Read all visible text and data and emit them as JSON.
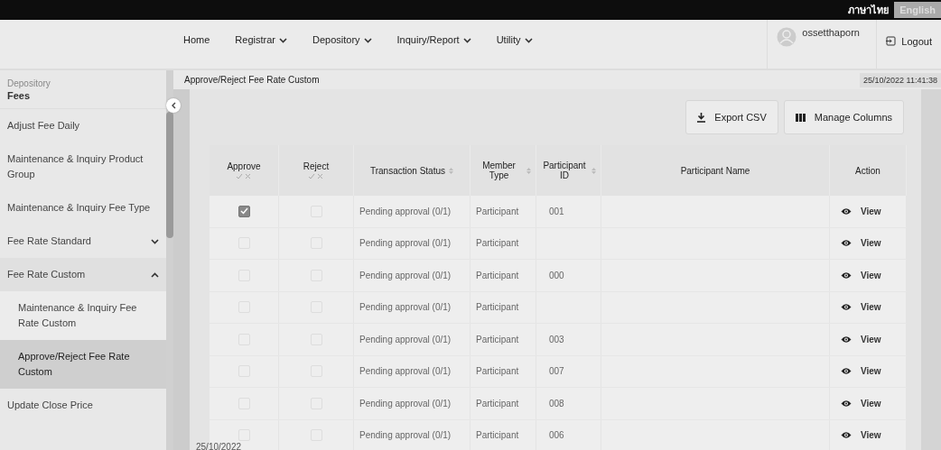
{
  "top_bar": {
    "languages": [
      {
        "label": "ภาษาไทย",
        "selected": true
      },
      {
        "label": "English",
        "selected": false
      }
    ]
  },
  "nav": {
    "items": [
      {
        "label": "Home",
        "dropdown": false
      },
      {
        "label": "Registrar",
        "dropdown": true
      },
      {
        "label": "Depository",
        "dropdown": true
      },
      {
        "label": "Inquiry/Report",
        "dropdown": true
      },
      {
        "label": "Utility",
        "dropdown": true
      }
    ],
    "username": "ossetthaporn",
    "logout": "Logout"
  },
  "sidebar": {
    "section": "Depository",
    "title": "Fees",
    "items": [
      {
        "label": "Adjust Fee Daily",
        "selected": false
      },
      {
        "label": "Maintenance & Inquiry Product Group",
        "selected": false
      },
      {
        "label": "Maintenance & Inquiry Fee Type",
        "selected": false
      },
      {
        "label": "Fee Rate Standard",
        "selected": false,
        "expanded": false
      },
      {
        "label": "Fee Rate Custom",
        "selected": false,
        "expanded": true,
        "children": [
          {
            "label": "Maintenance & Inquiry Fee Rate Custom",
            "selected": false
          },
          {
            "label": "Approve/Reject Fee Rate Custom",
            "selected": true
          }
        ]
      },
      {
        "label": "Update Close Price",
        "selected": false
      }
    ]
  },
  "page": {
    "title": "Approve/Reject Fee Rate Custom",
    "datetime": "25/10/2022 11:41:38"
  },
  "toolbar": {
    "buttons": [
      {
        "label": "Export CSV",
        "kind": "download"
      },
      {
        "label": "Manage Columns",
        "kind": "columns"
      }
    ]
  },
  "table": {
    "columns": [
      {
        "label": "Approve",
        "kind": "check"
      },
      {
        "label": "Reject",
        "kind": "check"
      },
      {
        "label": "Transaction Status",
        "kind": "sort"
      },
      {
        "label": "Member Type",
        "kind": "sort"
      },
      {
        "label": "Participant ID",
        "kind": "sort"
      },
      {
        "label": "Participant Name",
        "kind": "plain"
      },
      {
        "label": "Action",
        "kind": "plain"
      }
    ],
    "rows": [
      {
        "approve": true,
        "reject": false,
        "status": "Pending approval (0/1)",
        "member_type": "Participant",
        "participant_id": "001",
        "action": "View"
      },
      {
        "approve": false,
        "reject": false,
        "status": "Pending approval (0/1)",
        "member_type": "Participant",
        "participant_id": "",
        "action": "View"
      },
      {
        "approve": false,
        "reject": false,
        "status": "Pending approval (0/1)",
        "member_type": "Participant",
        "participant_id": "000",
        "action": "View"
      },
      {
        "approve": false,
        "reject": false,
        "status": "Pending approval (0/1)",
        "member_type": "Participant",
        "participant_id": "",
        "action": "View"
      },
      {
        "approve": false,
        "reject": false,
        "status": "Pending approval (0/1)",
        "member_type": "Participant",
        "participant_id": "003",
        "action": "View"
      },
      {
        "approve": false,
        "reject": false,
        "status": "Pending approval (0/1)",
        "member_type": "Participant",
        "participant_id": "007",
        "action": "View"
      },
      {
        "approve": false,
        "reject": false,
        "status": "Pending approval (0/1)",
        "member_type": "Participant",
        "participant_id": "008",
        "action": "View"
      },
      {
        "approve": false,
        "reject": false,
        "status": "Pending approval (0/1)",
        "member_type": "Participant",
        "participant_id": "006",
        "action": "View"
      }
    ]
  },
  "footer": {
    "date": "25/10/2022"
  }
}
